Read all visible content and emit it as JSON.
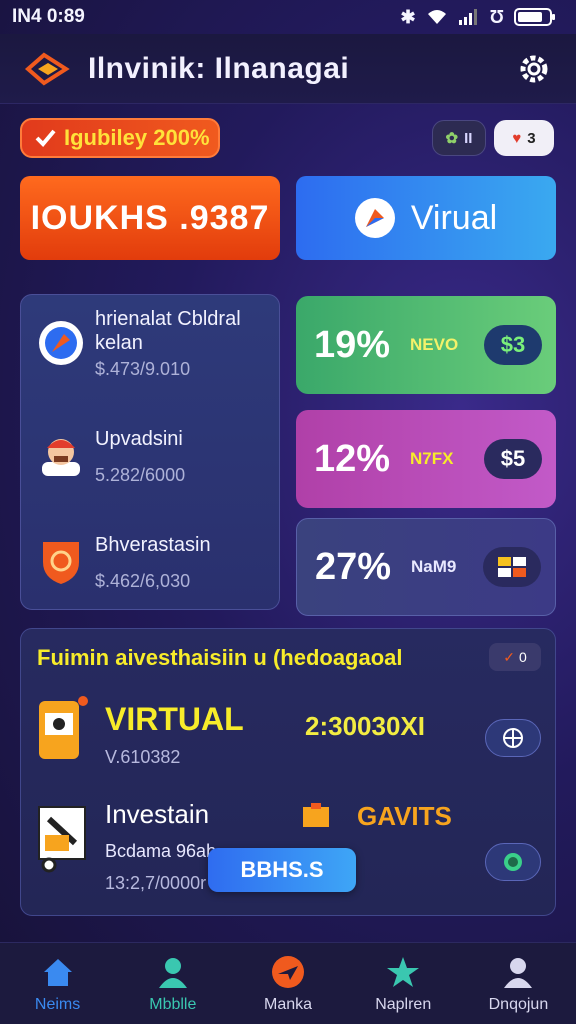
{
  "status_bar": {
    "time": "IN4 0:89"
  },
  "header": {
    "title": "Ilnvinik: Ilnanagai"
  },
  "badge": {
    "label": "Igubiley 200%"
  },
  "pills": [
    {
      "text": "II"
    },
    {
      "text": "3"
    }
  ],
  "big_buttons": {
    "orange_label": "IOUKHS .9387",
    "blue_label": "Virual"
  },
  "left_list": [
    {
      "title": "hrienalat Cbldral kelan",
      "sub": "$.473/9.010",
      "icon": "compass-icon"
    },
    {
      "title": "Upvadsini",
      "sub": "5.282/6000",
      "icon": "avatar-icon"
    },
    {
      "title": "Bhverastasin",
      "sub": "$.462/6,030",
      "icon": "shield-icon"
    }
  ],
  "stats": [
    {
      "pct": "19%",
      "label": "NEVO",
      "chip": "$3",
      "color": "#3aa86a"
    },
    {
      "pct": "12%",
      "label": "N7FX",
      "chip": "$5",
      "color": "#b040a8"
    },
    {
      "pct": "27%",
      "label": "NaM9",
      "chip": "",
      "color": "#3a427e"
    }
  ],
  "bottom_panel": {
    "title": "Fuimin aivesthaisiin u (hedoagaoal",
    "check_text": "0",
    "rows": [
      {
        "title": "VIRTUAL",
        "sub": "V.610382",
        "value": "2:30030XI"
      },
      {
        "title": "Investain",
        "sub": "Bcdama 96ab",
        "sub2": "13:2,7/0000r",
        "value": "GAVITS"
      }
    ],
    "cta": "BBHS.S"
  },
  "nav": [
    {
      "label": "Neims",
      "icon": "home-icon",
      "color": "#3a8af0"
    },
    {
      "label": "Mbblle",
      "icon": "person-icon",
      "color": "#3ac7b0"
    },
    {
      "label": "Manka",
      "icon": "plane-icon",
      "color": "#f05a1e"
    },
    {
      "label": "Naplren",
      "icon": "star-icon",
      "color": "#3ac7b0"
    },
    {
      "label": "Dnqojun",
      "icon": "user-icon",
      "color": "#d8d7ee"
    }
  ],
  "colors": {
    "accent_yellow": "#f7ec2a",
    "orange": "#f05a1e",
    "blue": "#3aa9f0"
  }
}
